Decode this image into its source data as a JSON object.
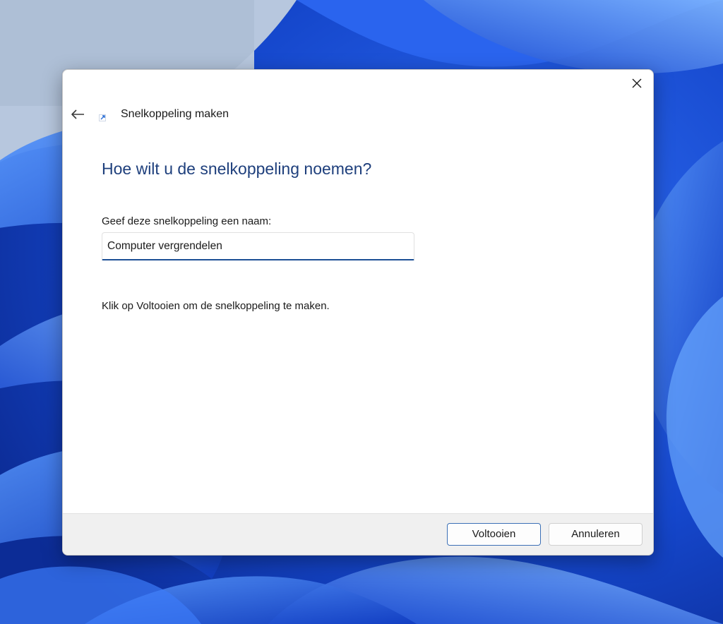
{
  "dialog": {
    "wizard_title": "Snelkoppeling maken",
    "heading": "Hoe wilt u de snelkoppeling noemen?",
    "name_label": "Geef deze snelkoppeling een naam:",
    "name_value": "Computer vergrendelen",
    "instruction": "Klik op Voltooien om de snelkoppeling te maken.",
    "finish_label": "Voltooien",
    "cancel_label": "Annuleren"
  },
  "icons": {
    "back": "back-arrow-icon",
    "close": "close-icon",
    "wizard": "shortcut-icon"
  },
  "colors": {
    "heading": "#1e3f7c",
    "accent": "#1c4f95",
    "wallpaper": "#1a4fd8"
  }
}
